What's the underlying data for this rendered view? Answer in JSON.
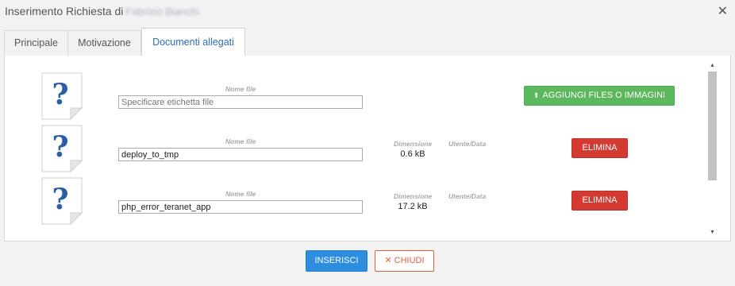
{
  "window": {
    "title": "Inserimento Richiesta di",
    "title_user": "Fabrizio Bianchi",
    "close_icon": "close-icon"
  },
  "tabs": [
    {
      "label": "Principale"
    },
    {
      "label": "Motivazione"
    },
    {
      "label": "Documenti allegati",
      "active": true
    }
  ],
  "columns": {
    "name": "Nome file",
    "size": "Dimensione",
    "user_date": "Utente/Data"
  },
  "new_file": {
    "placeholder": "Specificare etichetta file",
    "add_button": "AGGIUNGI FILES O IMMAGINI",
    "icon": "upload-arrow-icon"
  },
  "files": [
    {
      "name": "deploy_to_tmp",
      "size": "0.6 kB",
      "delete_label": "ELIMINA"
    },
    {
      "name": "php_error_teranet_app",
      "size": "17.2 kB",
      "delete_label": "ELIMINA"
    }
  ],
  "footer": {
    "insert_label": "INSERISCI",
    "close_label": "CHIUDI"
  },
  "colors": {
    "accent": "#2d8ee0",
    "success": "#5cb85c",
    "danger": "#d33a32",
    "close_outline": "#e0623d",
    "tab_active_text": "#2a6ebb"
  }
}
